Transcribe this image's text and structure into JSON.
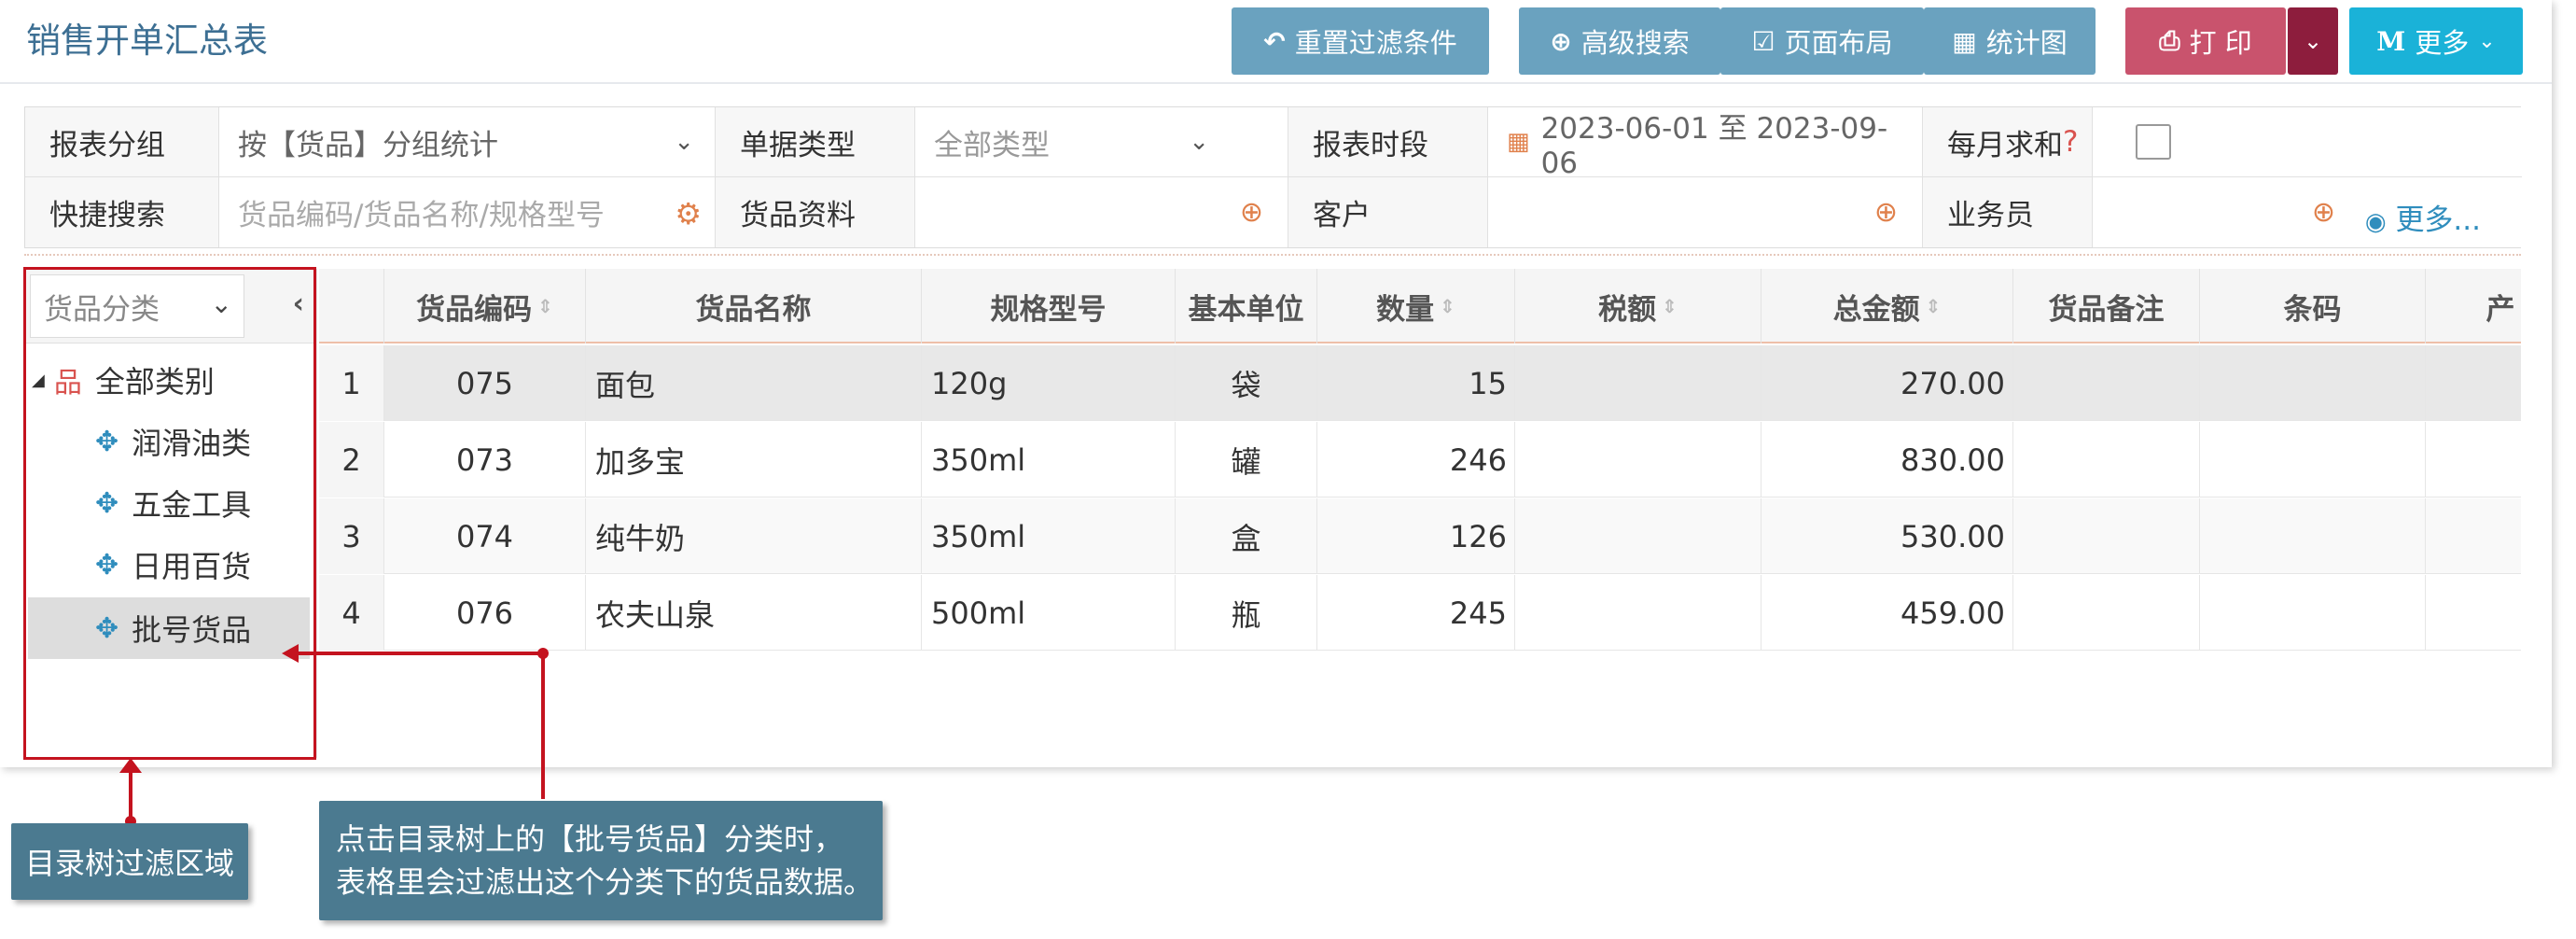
{
  "page": {
    "title": "销售开单汇总表"
  },
  "toolbar": {
    "reset_filter": "重置过滤条件",
    "advanced_search": "高级搜索",
    "page_layout": "页面布局",
    "stats_chart": "统计图",
    "print": "打 印",
    "more": "更多",
    "more_icon_letter": "M"
  },
  "filters": {
    "group_label": "报表分组",
    "group_value": "按【货品】分组统计",
    "doc_type_label": "单据类型",
    "doc_type_value": "全部类型",
    "period_label": "报表时段",
    "period_value": "2023-06-01 至 2023-09-06",
    "monthly_sum_label": "每月求和",
    "monthly_sum_help": "?",
    "quick_search_label": "快捷搜索",
    "quick_search_placeholder": "货品编码/货品名称/规格型号",
    "goods_label": "货品资料",
    "customer_label": "客户",
    "salesman_label": "业务员",
    "more_link": "更多..."
  },
  "tree": {
    "selector_value": "货品分类",
    "nodes": [
      {
        "label": "全部类别"
      },
      {
        "label": "润滑油类"
      },
      {
        "label": "五金工具"
      },
      {
        "label": "日用百货"
      },
      {
        "label": "批号货品"
      }
    ]
  },
  "table": {
    "columns": [
      "货品编码",
      "货品名称",
      "规格型号",
      "基本单位",
      "数量",
      "税额",
      "总金额",
      "货品备注",
      "条码",
      "产"
    ],
    "rows": [
      {
        "idx": "1",
        "code": "075",
        "name": "面包",
        "spec": "120g",
        "unit": "袋",
        "qty": "15",
        "tax": "",
        "total": "270.00"
      },
      {
        "idx": "2",
        "code": "073",
        "name": "加多宝",
        "spec": "350ml",
        "unit": "罐",
        "qty": "246",
        "tax": "",
        "total": "830.00"
      },
      {
        "idx": "3",
        "code": "074",
        "name": "纯牛奶",
        "spec": "350ml",
        "unit": "盒",
        "qty": "126",
        "tax": "",
        "total": "530.00"
      },
      {
        "idx": "4",
        "code": "076",
        "name": "农夫山泉",
        "spec": "500ml",
        "unit": "瓶",
        "qty": "245",
        "tax": "",
        "total": "459.00"
      }
    ]
  },
  "annotations": {
    "left_callout": "目录树过滤区域",
    "right_callout_line1": "点击目录树上的【批号货品】分类时，",
    "right_callout_line2": "表格里会过滤出这个分类下的货品数据。",
    "highlight_color": "#c4131f"
  },
  "colors": {
    "title": "#3d6f93",
    "toolbar_blue": "#6aa2bf",
    "print_pink": "#c9536d",
    "print_dropdown": "#8d1d3d",
    "more_cyan": "#1ab2d8",
    "callout_bg": "#4b7a90"
  }
}
